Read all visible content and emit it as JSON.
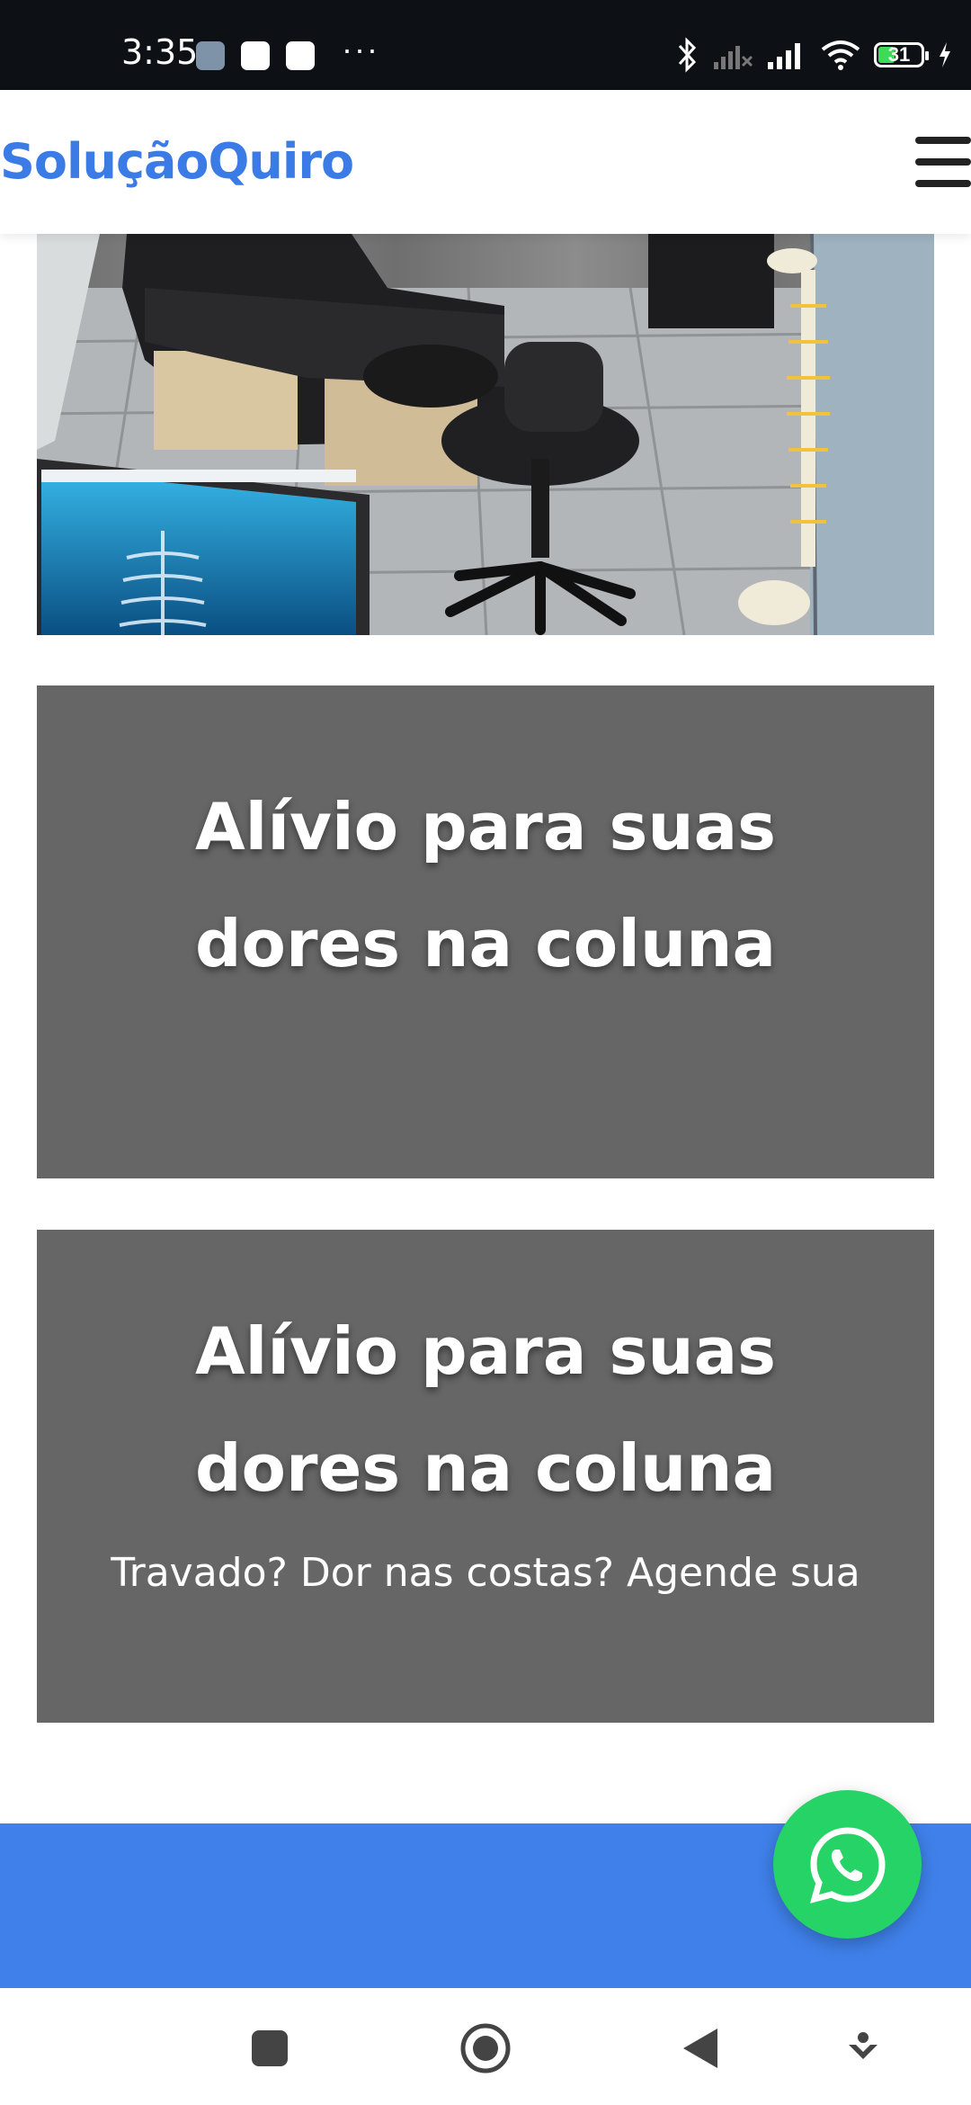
{
  "status_bar": {
    "time": "3:35",
    "icons": [
      "gallery-notification-icon",
      "app-notification-icon",
      "app-notification-icon",
      "more-dots-icon",
      "bluetooth-icon",
      "no-signal-icon",
      "signal-icon",
      "wifi-icon",
      "battery-icon",
      "charging-icon"
    ],
    "battery_level": "31",
    "more": "···"
  },
  "header": {
    "brand": "SoluçãoQuiro",
    "menu_icon": "hamburger-menu-icon"
  },
  "hero": {
    "image_icon": "clinic-photo"
  },
  "banners": [
    {
      "title": "Alívio para suas dores na coluna"
    },
    {
      "title": "Alívio para suas dores na coluna",
      "text": "Travado? Dor nas costas? Agende sua"
    }
  ],
  "floating": {
    "icon": "whatsapp-icon"
  },
  "nav": {
    "icons": [
      "recents-icon",
      "home-icon",
      "back-icon",
      "assist-icon"
    ]
  },
  "colors": {
    "brand": "#3b7be6",
    "banner_bg": "#666666",
    "footer_band": "#3f80ea",
    "whatsapp": "#25d366",
    "status_bar": "#0d1115"
  }
}
